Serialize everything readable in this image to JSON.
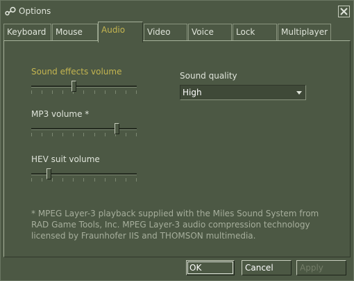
{
  "window": {
    "title": "Options",
    "close_icon": "close-icon",
    "app_icon": "steam-icon"
  },
  "tabs": [
    {
      "label": "Keyboard",
      "active": false
    },
    {
      "label": "Mouse",
      "active": false
    },
    {
      "label": "Audio",
      "active": true
    },
    {
      "label": "Video",
      "active": false
    },
    {
      "label": "Voice",
      "active": false
    },
    {
      "label": "Lock",
      "active": false
    },
    {
      "label": "Multiplayer",
      "active": false
    }
  ],
  "audio": {
    "sound_effects": {
      "label": "Sound effects volume",
      "level": 0.4
    },
    "mp3": {
      "label": "MP3 volume *",
      "level": 0.83
    },
    "hev": {
      "label": "HEV suit volume",
      "level": 0.15
    },
    "sound_quality": {
      "label": "Sound quality",
      "value": "High"
    },
    "note": "* MPEG Layer-3 playback supplied with the Miles Sound System from RAD Game Tools, Inc. MPEG Layer-3 audio compression technology licensed by Fraunhofer IIS and THOMSON multimedia."
  },
  "buttons": {
    "ok": "OK",
    "cancel": "Cancel",
    "apply": "Apply"
  },
  "colors": {
    "background": "#4c5844",
    "accent_text": "#c4b550",
    "text": "#dfe4da"
  }
}
